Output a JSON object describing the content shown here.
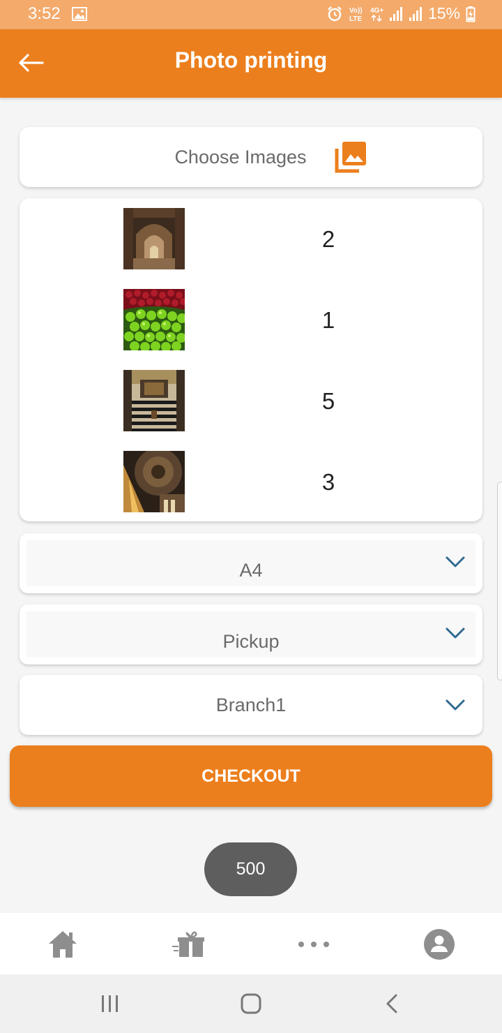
{
  "status_bar": {
    "time": "3:52",
    "battery": "15%",
    "icons": [
      "image-icon",
      "alarm-icon",
      "volte-icon",
      "4g-icon",
      "signal-icon",
      "signal-icon",
      "battery-charging-icon"
    ]
  },
  "header": {
    "title": "Photo printing",
    "back_icon": "arrow-left-icon",
    "background": "#ec7f1d"
  },
  "chooser": {
    "label": "Choose Images",
    "icon": "photo-library-icon",
    "icon_color": "#ec7f1d"
  },
  "images": [
    {
      "thumbnail": "arched-stone-corridor",
      "quantity": "2"
    },
    {
      "thumbnail": "green-limes-and-red-cherries",
      "quantity": "1"
    },
    {
      "thumbnail": "striped-marble-courtyard",
      "quantity": "5"
    },
    {
      "thumbnail": "dome-interior",
      "quantity": "3"
    }
  ],
  "options": {
    "size": "A4",
    "delivery": "Pickup",
    "branch": "Branch1",
    "dropdown_icon": "chevron-down-icon",
    "chevron_color": "#2f6a92"
  },
  "checkout": {
    "label": "CHECKOUT",
    "color": "#ec7f1d"
  },
  "total": "500",
  "bottom_nav": {
    "items": [
      "home-icon",
      "gift-icon",
      "more-icon",
      "profile-icon"
    ]
  },
  "system_nav": {
    "items": [
      "recents-icon",
      "home-button-icon",
      "back-chevron-icon"
    ]
  }
}
